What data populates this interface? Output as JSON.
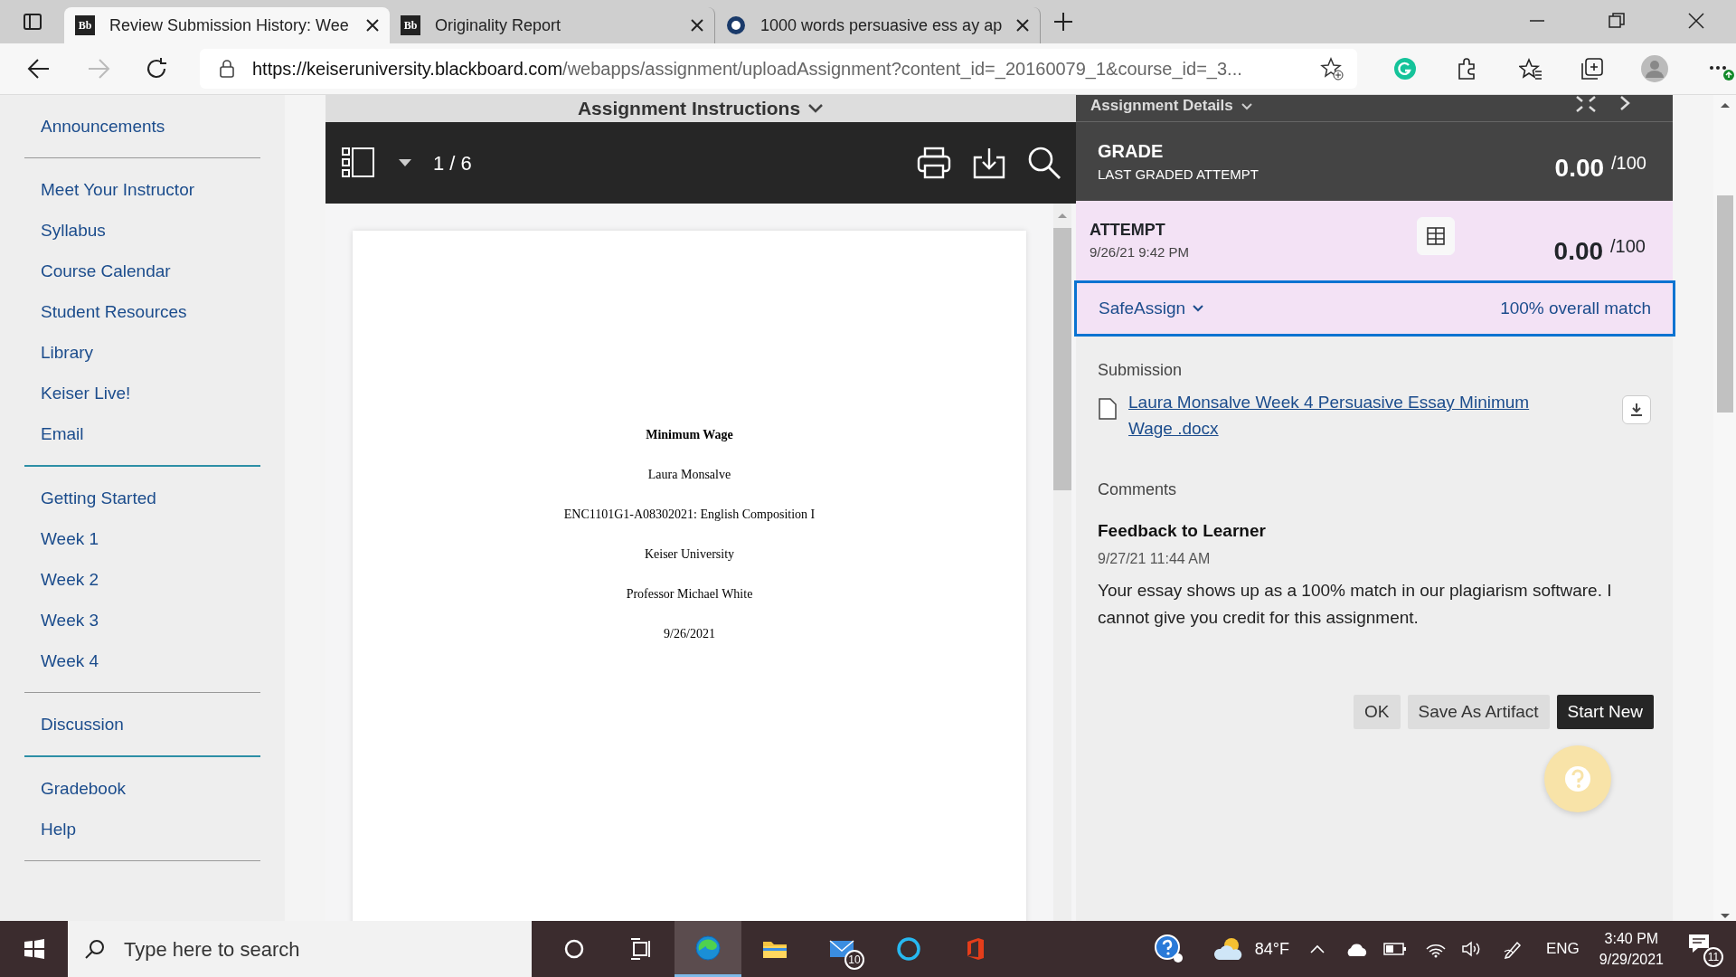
{
  "browser": {
    "tabs": [
      {
        "kind": "text-favicon",
        "favicon": "Bb",
        "title": "Review Submission History: Wee",
        "selected": true
      },
      {
        "kind": "text-favicon",
        "favicon": "Bb",
        "title": "Originality Report",
        "selected": false
      },
      {
        "kind": "ring-favicon",
        "title": "1000 words persuasive ess ay ap",
        "selected": false
      }
    ],
    "url": {
      "host": "https://keiseruniversity.blackboard.com",
      "path": "/webapps/assignment/uploadAssignment?content_id=_20160079_1&course_id=_3..."
    }
  },
  "sidebar": {
    "sections": [
      {
        "accent_divider": false,
        "items": [
          "Announcements"
        ]
      },
      {
        "accent_divider": true,
        "items": [
          "Meet Your Instructor",
          "Syllabus",
          "Course Calendar",
          "Student Resources",
          "Library",
          "Keiser Live!",
          "Email"
        ]
      },
      {
        "accent_divider": false,
        "items": [
          "Getting Started",
          "Week 1",
          "Week 2",
          "Week 3",
          "Week 4"
        ]
      },
      {
        "accent_divider": true,
        "items": [
          "Discussion"
        ]
      },
      {
        "accent_divider": false,
        "items": [
          "Gradebook",
          "Help"
        ]
      }
    ]
  },
  "viewer": {
    "title": "Assignment Instructions",
    "page_indicator": "1 / 6",
    "lines": [
      {
        "kind": "title",
        "text": "Minimum Wage"
      },
      {
        "kind": "line",
        "text": "Laura Monsalve"
      },
      {
        "kind": "line",
        "text": "ENC1101G1-A08302021: English Composition I"
      },
      {
        "kind": "line",
        "text": "Keiser University"
      },
      {
        "kind": "line",
        "text": "Professor Michael White"
      },
      {
        "kind": "line",
        "text": "9/26/2021"
      }
    ]
  },
  "panel": {
    "title": "Assignment Details",
    "grade": {
      "label": "GRADE",
      "sublabel": "LAST GRADED ATTEMPT",
      "score": "0.00",
      "out_of": "/100"
    },
    "attempt": {
      "label": "ATTEMPT",
      "date": "9/26/21 9:42 PM",
      "score": "0.00",
      "out_of": "/100"
    },
    "safeassign": {
      "label": "SafeAssign",
      "match": "100% overall match"
    },
    "submission": {
      "label": "Submission",
      "file": "Laura Monsalve Week 4 Persuasive Essay Minimum Wage .docx"
    },
    "comments": {
      "label": "Comments",
      "title": "Feedback to Learner",
      "date": "9/27/21 11:44 AM",
      "text": "Your essay shows up as a 100% match in our plagiarism software. I cannot give you credit for this assignment."
    },
    "buttons": [
      {
        "label": "OK",
        "kind": "secondary"
      },
      {
        "label": "Save As Artifact",
        "kind": "secondary"
      },
      {
        "label": "Start New",
        "kind": "primary"
      }
    ]
  },
  "taskbar": {
    "search": {
      "placeholder": "Type here to search"
    },
    "apps": [
      {
        "kind": "cortana",
        "selected": false
      },
      {
        "kind": "taskview",
        "selected": false
      },
      {
        "kind": "edge",
        "selected": true
      },
      {
        "kind": "folder",
        "selected": false
      },
      {
        "kind": "mail",
        "badge": "10",
        "selected": false
      },
      {
        "kind": "alexa",
        "selected": false
      },
      {
        "kind": "office",
        "selected": false
      }
    ],
    "weather": "84°F",
    "language": "ENG",
    "time": "3:40 PM",
    "date": "9/29/2021",
    "notifications": "11"
  }
}
